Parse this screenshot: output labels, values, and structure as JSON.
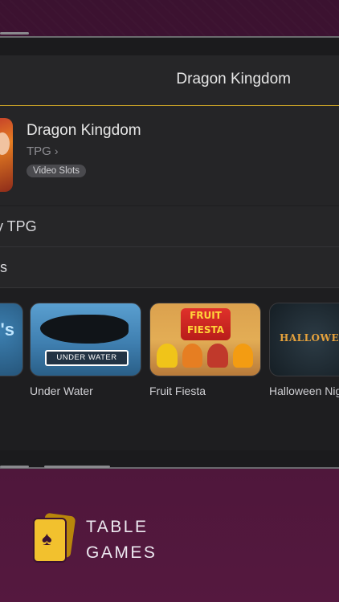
{
  "navbar": {
    "title": "Dragon Kingdom"
  },
  "app": {
    "name": "Dragon Kingdom",
    "developer": "TPG",
    "category_badge": "Video Slots"
  },
  "rows": {
    "more_by": "y TPG",
    "also": "ts"
  },
  "games": [
    {
      "name": "Under Water",
      "banner": "UNDER WATER"
    },
    {
      "name": "Fruit Fiesta",
      "banner": "FRUIT FIESTA"
    },
    {
      "name": "Halloween Nig",
      "banner": "HALLOWEEN"
    }
  ],
  "footer": {
    "line1": "TABLE",
    "line2": "GAMES"
  },
  "colors": {
    "accent_gold": "#c9a227",
    "background_plum": "#4a1638"
  }
}
